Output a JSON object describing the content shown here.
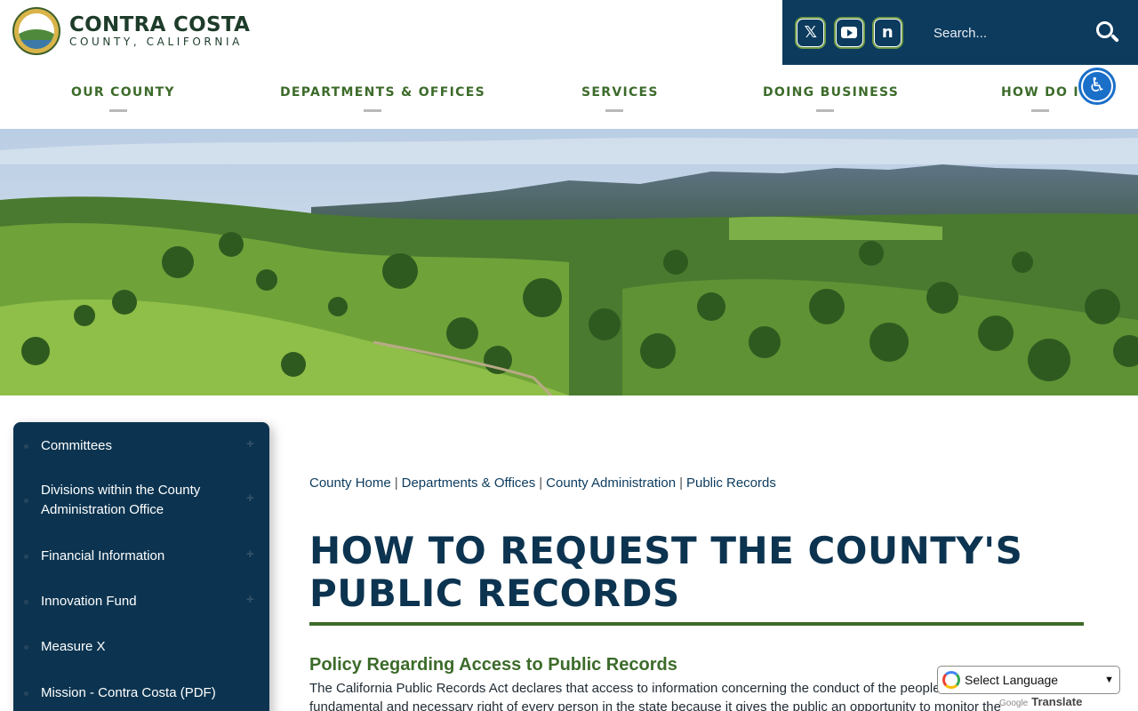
{
  "header": {
    "brand_title": "CONTRA COSTA",
    "brand_subtitle": "COUNTY, CALIFORNIA",
    "social": [
      {
        "name": "x-icon",
        "glyph": "𝕏"
      },
      {
        "name": "youtube-icon",
        "glyph": ""
      },
      {
        "name": "nextdoor-icon",
        "glyph": "n"
      }
    ],
    "search_placeholder": "Search...",
    "colors": {
      "navy": "#0c3b5e",
      "green": "#3c6b2a",
      "accessibility_blue": "#1a6fc9"
    }
  },
  "nav": {
    "items": [
      {
        "label": "OUR COUNTY"
      },
      {
        "label": "DEPARTMENTS & OFFICES"
      },
      {
        "label": "SERVICES"
      },
      {
        "label": "DOING BUSINESS"
      },
      {
        "label": "HOW DO I?"
      }
    ]
  },
  "sidebar": {
    "items": [
      {
        "label": "Committees",
        "expandable": true
      },
      {
        "label": "Divisions within the County Administration Office",
        "expandable": true
      },
      {
        "label": "Financial Information",
        "expandable": true
      },
      {
        "label": "Innovation Fund",
        "expandable": true
      },
      {
        "label": "Measure X",
        "expandable": false
      },
      {
        "label": "Mission - Contra Costa (PDF)",
        "expandable": false
      }
    ]
  },
  "breadcrumb": [
    "County Home",
    "Departments & Offices",
    "County Administration",
    "Public Records"
  ],
  "main": {
    "title": "HOW TO REQUEST THE COUNTY'S PUBLIC RECORDS",
    "section_heading": "Policy Regarding Access to Public Records",
    "body": "The California Public Records Act declares that access to information concerning the conduct of the people's business is a fundamental and necessary right of every person in the state because it gives the public an opportunity to monitor the"
  },
  "translate": {
    "select_label": "Select Language",
    "powered_prefix": "Google",
    "powered_label": "Translate"
  }
}
